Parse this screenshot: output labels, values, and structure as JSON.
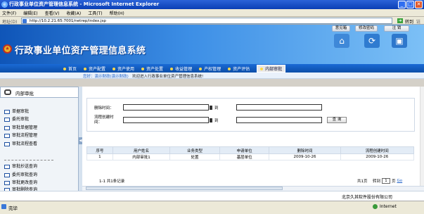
{
  "window": {
    "title": "行政事业单位资产管理信息系统 - Microsoft Internet Explorer"
  },
  "menu": [
    "文件(F)",
    "编辑(E)",
    "查看(V)",
    "收藏(A)",
    "工具(T)",
    "帮助(H)"
  ],
  "address": {
    "label": "地址(D)",
    "url": "http://10.2.21.65:7001/netrep/index.jsp",
    "go": "转到",
    "links": "链接"
  },
  "header": {
    "system_title": "行政事业单位资产管理信息系统",
    "top_links": [
      "意见箱",
      "修改密码",
      "注 销"
    ]
  },
  "nav": {
    "items": [
      "首页",
      "资产配置",
      "资产使用",
      "资产处置",
      "收益管理",
      "产权管理",
      "资产评估",
      "内部审批"
    ],
    "active": "内部审批"
  },
  "ticker": {
    "user_info": "您好：演示财政(演示财政)",
    "welcome": "欢迎进入行政事业单位资产管理信息系统!"
  },
  "sidebar": {
    "title": "内部审批",
    "items_top": [
      "单据审批",
      "委托审批",
      "审批单据管理",
      "审批流程管理",
      "审批流程查看"
    ],
    "items_bottom": [
      "审批抄送查询",
      "委托审批查询",
      "审批更改查询",
      "审批删除查询"
    ]
  },
  "filter": {
    "delete_time_label": "删除时间：",
    "create_time_label": "流程创建时间：",
    "to_label": "到",
    "query_button": "查 询"
  },
  "table": {
    "columns": [
      "序号",
      "用户姓名",
      "业务类型",
      "申请单位",
      "删除时间",
      "流程创建时间"
    ],
    "rows": [
      [
        "1",
        "内部审批1",
        "处置",
        "基层单位",
        "2009-10-26",
        "2009-10-26"
      ]
    ]
  },
  "pager": {
    "summary": "1-1 共1条记录",
    "total_pages": "共1页",
    "goto_label": "转到",
    "page_value": "1",
    "page_unit": "页",
    "go": "Go"
  },
  "footer": {
    "copyright": "北京久其软件股份有限公司"
  },
  "status": {
    "left": "完毕",
    "zone": "Internet"
  },
  "colors": {
    "brand_blue": "#0f55b8",
    "nav_blue": "#1a6ad6",
    "emblem_gold": "#e8b128"
  }
}
